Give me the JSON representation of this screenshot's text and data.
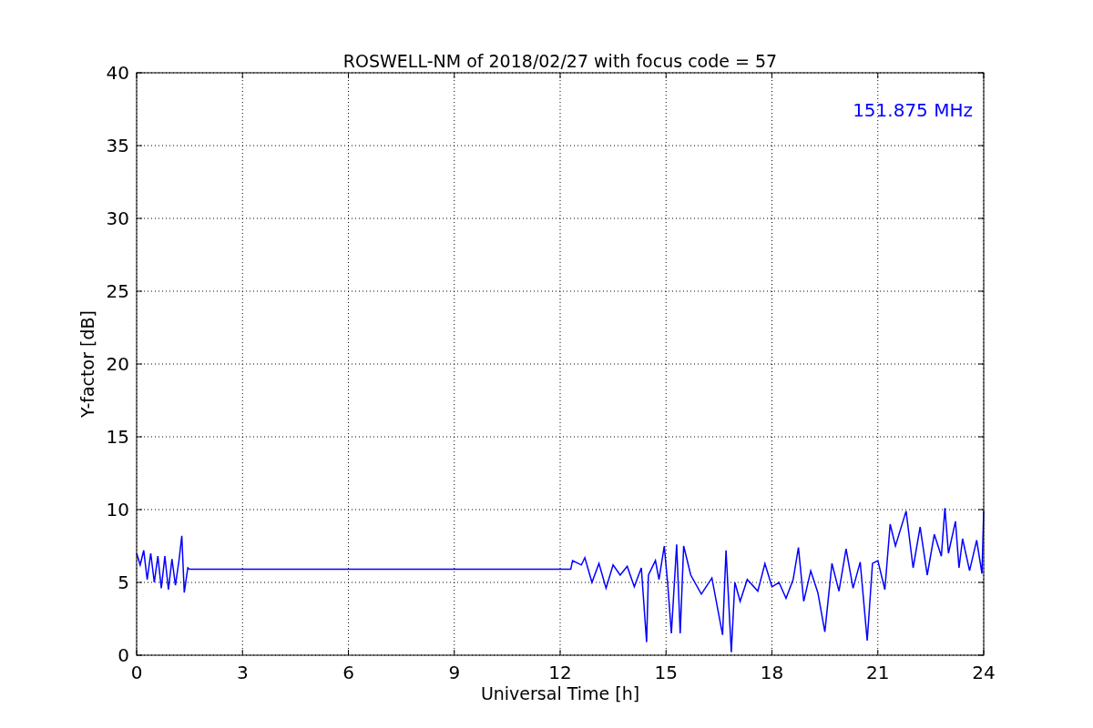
{
  "figure": {
    "chart_data": {
      "type": "line",
      "title": "ROSWELL-NM of 2018/02/27 with focus code = 57",
      "xlabel": "Universal Time [h]",
      "ylabel": "Y-factor [dB]",
      "grid": true,
      "xlim": [
        0,
        24
      ],
      "ylim": [
        0,
        40
      ],
      "xticks": [
        0,
        3,
        6,
        9,
        12,
        15,
        18,
        21,
        24
      ],
      "yticks": [
        0,
        5,
        10,
        15,
        20,
        25,
        30,
        35,
        40
      ],
      "x": [
        0,
        0.1,
        0.2,
        0.3,
        0.4,
        0.5,
        0.6,
        0.7,
        0.8,
        0.9,
        1.0,
        1.1,
        1.2,
        1.28,
        1.35,
        1.45,
        1.5,
        12.3,
        12.35,
        12.6,
        12.7,
        12.9,
        13.1,
        13.3,
        13.5,
        13.7,
        13.9,
        14.1,
        14.3,
        14.45,
        14.5,
        14.7,
        14.8,
        14.95,
        15.05,
        15.15,
        15.3,
        15.4,
        15.5,
        15.7,
        16.0,
        16.3,
        16.6,
        16.7,
        16.85,
        16.95,
        17.1,
        17.3,
        17.6,
        17.8,
        18.0,
        18.2,
        18.4,
        18.6,
        18.75,
        18.9,
        19.1,
        19.3,
        19.5,
        19.7,
        19.9,
        20.1,
        20.3,
        20.5,
        20.7,
        20.85,
        21.0,
        21.2,
        21.35,
        21.5,
        21.8,
        22.0,
        22.2,
        22.4,
        22.6,
        22.8,
        22.9,
        23.0,
        23.2,
        23.3,
        23.4,
        23.6,
        23.8,
        23.95,
        24.0
      ],
      "series": [
        {
          "name": "151.875 MHz",
          "color": "#0000ff",
          "values": [
            7,
            6.2,
            7.2,
            5.2,
            7.0,
            5.0,
            6.8,
            4.6,
            6.8,
            4.5,
            6.6,
            4.8,
            6.5,
            8.2,
            4.3,
            6.0,
            5.9,
            5.9,
            6.5,
            6.2,
            6.7,
            5.0,
            6.3,
            4.6,
            6.2,
            5.5,
            6.1,
            4.7,
            6.0,
            0.9,
            5.5,
            6.5,
            5.2,
            7.5,
            4.8,
            1.5,
            7.6,
            1.5,
            7.5,
            5.5,
            4.2,
            5.3,
            1.4,
            7.2,
            0.2,
            5.0,
            3.7,
            5.2,
            4.4,
            6.3,
            4.7,
            5.0,
            3.9,
            5.2,
            7.4,
            3.7,
            5.8,
            4.3,
            1.6,
            6.3,
            4.4,
            7.3,
            4.6,
            6.4,
            1.0,
            6.3,
            6.5,
            4.5,
            9.0,
            7.5,
            9.9,
            6.0,
            8.8,
            5.5,
            8.3,
            6.8,
            10.1,
            7.0,
            9.2,
            6.0,
            8.0,
            5.8,
            7.9,
            5.6,
            9.9
          ]
        }
      ]
    }
  }
}
